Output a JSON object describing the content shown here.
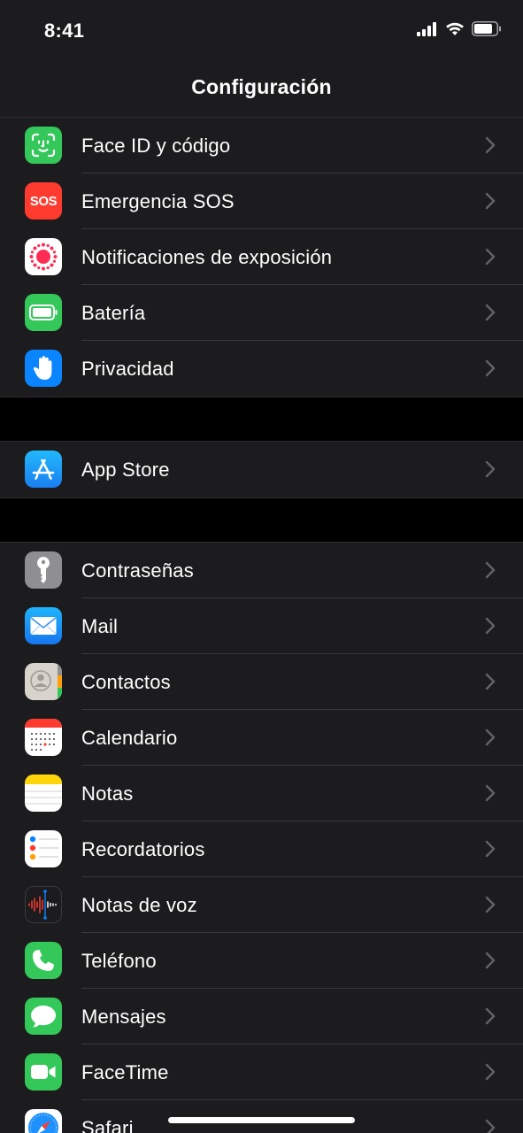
{
  "status_bar": {
    "time": "8:41"
  },
  "nav": {
    "title": "Configuración"
  },
  "groups": [
    {
      "items": [
        {
          "label": "Face ID y código",
          "icon": "face-id-icon",
          "color": "#34c759"
        },
        {
          "label": "Emergencia SOS",
          "icon": "sos-icon",
          "icon_text": "SOS",
          "color": "#ff3b30"
        },
        {
          "label": "Notificaciones de exposición",
          "icon": "exposure-notifications-icon",
          "color": "#ffffff"
        },
        {
          "label": "Batería",
          "icon": "battery-icon",
          "color": "#34c759"
        },
        {
          "label": "Privacidad",
          "icon": "hand-icon",
          "color": "#0a84ff"
        }
      ]
    },
    {
      "items": [
        {
          "label": "App Store",
          "icon": "app-store-icon",
          "color": "#1c9bf6"
        }
      ]
    },
    {
      "items": [
        {
          "label": "Contraseñas",
          "icon": "key-icon",
          "color": "#8e8e93"
        },
        {
          "label": "Mail",
          "icon": "mail-icon",
          "color": "#1e90ff"
        },
        {
          "label": "Contactos",
          "icon": "contacts-icon",
          "color": "#d8d4cc"
        },
        {
          "label": "Calendario",
          "icon": "calendar-icon",
          "color": "#ffffff"
        },
        {
          "label": "Notas",
          "icon": "notes-icon",
          "color": "#ffd60a"
        },
        {
          "label": "Recordatorios",
          "icon": "reminders-icon",
          "color": "#ffffff"
        },
        {
          "label": "Notas de voz",
          "icon": "voice-memos-icon",
          "color": "#1c1c1e"
        },
        {
          "label": "Teléfono",
          "icon": "phone-icon",
          "color": "#34c759"
        },
        {
          "label": "Mensajes",
          "icon": "messages-icon",
          "color": "#34c759"
        },
        {
          "label": "FaceTime",
          "icon": "facetime-icon",
          "color": "#34c759"
        },
        {
          "label": "Safari",
          "icon": "safari-icon",
          "color": "#1e90ff"
        }
      ]
    }
  ]
}
